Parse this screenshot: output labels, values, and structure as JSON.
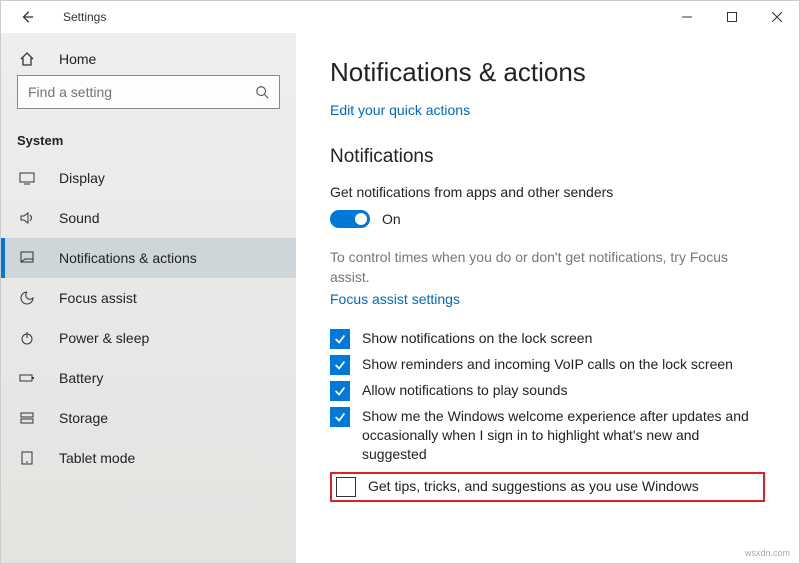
{
  "window": {
    "title": "Settings"
  },
  "sidebar": {
    "home": "Home",
    "search_placeholder": "Find a setting",
    "section": "System",
    "items": [
      {
        "label": "Display"
      },
      {
        "label": "Sound"
      },
      {
        "label": "Notifications & actions"
      },
      {
        "label": "Focus assist"
      },
      {
        "label": "Power & sleep"
      },
      {
        "label": "Battery"
      },
      {
        "label": "Storage"
      },
      {
        "label": "Tablet mode"
      }
    ]
  },
  "content": {
    "title": "Notifications & actions",
    "quick_actions_link": "Edit your quick actions",
    "notifications_header": "Notifications",
    "senders_desc": "Get notifications from apps and other senders",
    "toggle_label": "On",
    "focus_hint": "To control times when you do or don't get notifications, try Focus assist.",
    "focus_link": "Focus assist settings",
    "checks": [
      {
        "checked": true,
        "label": "Show notifications on the lock screen"
      },
      {
        "checked": true,
        "label": "Show reminders and incoming VoIP calls on the lock screen"
      },
      {
        "checked": true,
        "label": "Allow notifications to play sounds"
      },
      {
        "checked": true,
        "label": "Show me the Windows welcome experience after updates and occasionally when I sign in to highlight what's new and suggested"
      },
      {
        "checked": false,
        "label": "Get tips, tricks, and suggestions as you use Windows"
      }
    ]
  },
  "watermark": "wsxdn.com"
}
